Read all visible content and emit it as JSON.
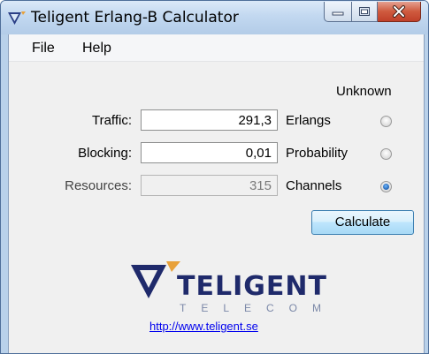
{
  "window": {
    "title": "Teligent Erlang-B Calculator",
    "icon": "teligent-app-icon",
    "buttons": [
      "minimize",
      "maximize",
      "close"
    ]
  },
  "menu": {
    "items": [
      "File",
      "Help"
    ]
  },
  "form": {
    "unknown_header": "Unknown",
    "rows": [
      {
        "label": "Traffic:",
        "value": "291,3",
        "unit": "Erlangs",
        "unknown_selected": false,
        "readonly": false
      },
      {
        "label": "Blocking:",
        "value": "0,01",
        "unit": "Probability",
        "unknown_selected": false,
        "readonly": false
      },
      {
        "label": "Resources:",
        "value": "315",
        "unit": "Channels",
        "unknown_selected": true,
        "readonly": true
      }
    ],
    "calculate_label": "Calculate"
  },
  "branding": {
    "logo_word": "TELIGENT",
    "logo_sub": "TELECOM",
    "link_text": "http://www.teligent.se",
    "colors": {
      "navy": "#1f2a6b",
      "orange": "#e8a13a",
      "link": "#0000ee"
    }
  }
}
